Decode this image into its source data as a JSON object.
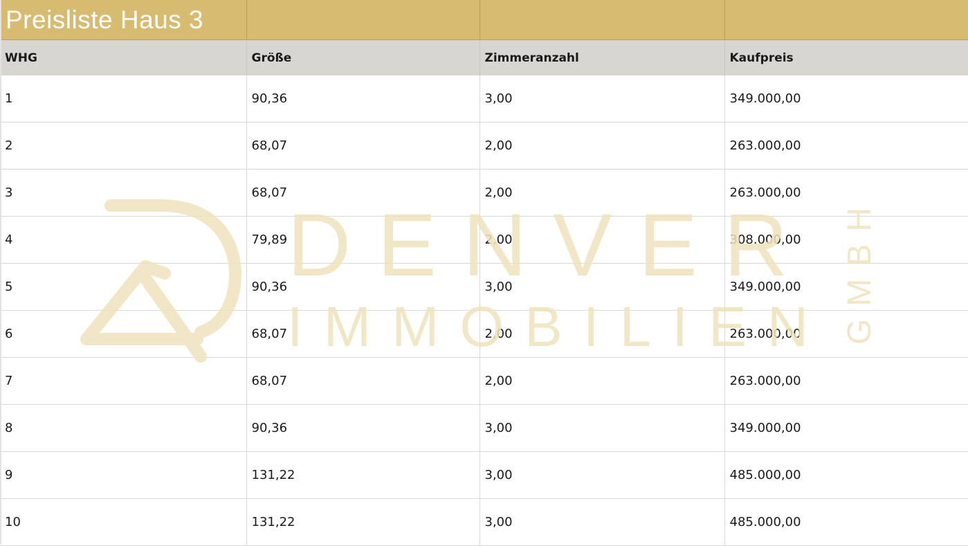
{
  "title": "Preisliste Haus 3",
  "columns": [
    "WHG",
    "Größe",
    "Zimmeranzahl",
    "Kaufpreis"
  ],
  "rows": [
    [
      "1",
      "90,36",
      "3,00",
      "349.000,00"
    ],
    [
      "2",
      "68,07",
      "2,00",
      "263.000,00"
    ],
    [
      "3",
      "68,07",
      "2,00",
      "263.000,00"
    ],
    [
      "4",
      "79,89",
      "2,00",
      "308.000,00"
    ],
    [
      "5",
      "90,36",
      "3,00",
      "349.000,00"
    ],
    [
      "6",
      "68,07",
      "2,00",
      "263.000,00"
    ],
    [
      "7",
      "68,07",
      "2,00",
      "263.000,00"
    ],
    [
      "8",
      "90,36",
      "3,00",
      "349.000,00"
    ],
    [
      "9",
      "131,22",
      "3,00",
      "485.000,00"
    ],
    [
      "10",
      "131,22",
      "3,00",
      "485.000,00"
    ]
  ],
  "watermark": {
    "line1": "DENVER",
    "line2": "IMMOBILIEN",
    "side": "GMBH",
    "color": "#efe3bd"
  },
  "colors": {
    "title_bg": "#d6bb70",
    "header_bg": "#d8d6d0"
  }
}
